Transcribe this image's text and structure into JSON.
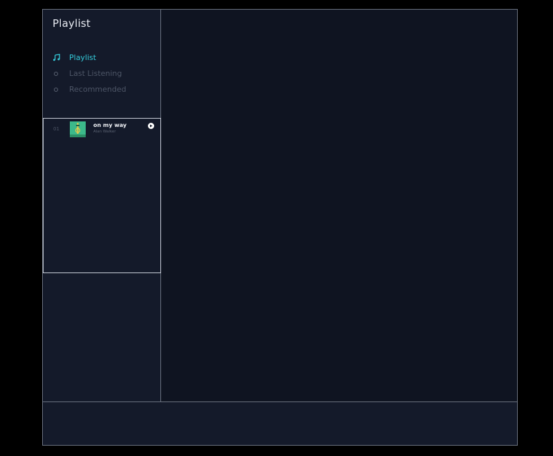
{
  "sidebar": {
    "title": "Playlist",
    "menu": [
      {
        "label": "Playlist",
        "icon": "music-note-icon",
        "active": true
      },
      {
        "label": "Last Listening",
        "icon": "dot-icon",
        "active": false
      },
      {
        "label": "Recommended",
        "icon": "dot-icon",
        "active": false
      }
    ]
  },
  "tracks": [
    {
      "number": "01",
      "title": "on my way",
      "artist": "Alan Walker",
      "cover_color": "#3fbf8e"
    }
  ],
  "colors": {
    "accent": "#34c9d8",
    "background": "#0f1421",
    "panel": "#141a2a",
    "muted_text": "#4d5566"
  }
}
